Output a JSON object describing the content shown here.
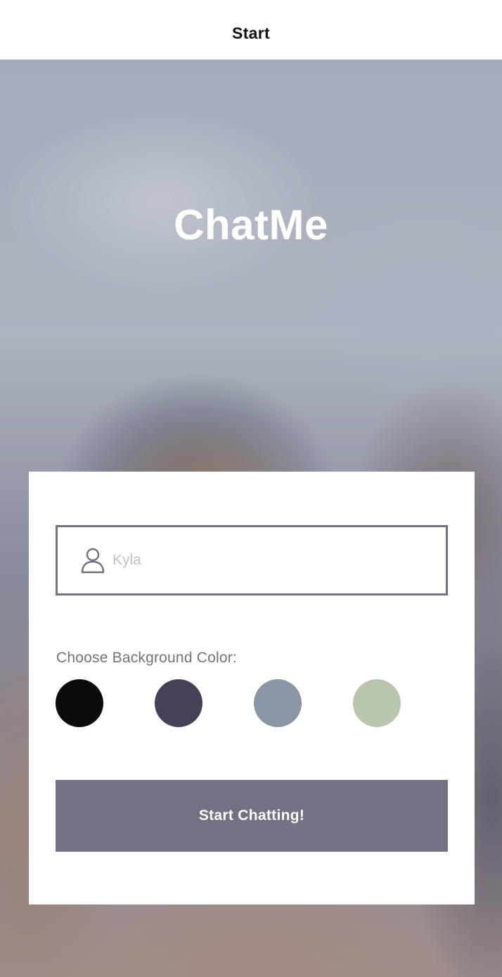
{
  "nav": {
    "title": "Start"
  },
  "hero": {
    "app_title": "ChatMe"
  },
  "form": {
    "name_field": {
      "placeholder": "Kyla",
      "value": "",
      "icon": "person-icon"
    },
    "color_label": "Choose Background Color:",
    "colors": [
      {
        "name": "black",
        "hex": "#090C08"
      },
      {
        "name": "dark-purple",
        "hex": "#474056"
      },
      {
        "name": "slate-gray",
        "hex": "#8A95A5"
      },
      {
        "name": "sage-green",
        "hex": "#B9C6AE"
      }
    ],
    "start_button_label": "Start Chatting!",
    "start_button_color": "#757083",
    "text_color": "#757083"
  }
}
